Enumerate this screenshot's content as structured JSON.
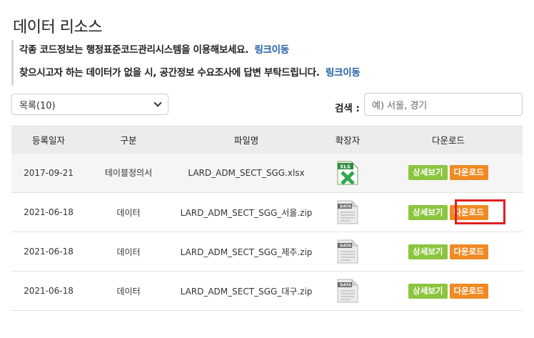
{
  "page": {
    "title": "데이터 리소스"
  },
  "notice": {
    "line1": "각종 코드정보는 행정표준코드관리시스템을 이용해보세요.",
    "line1_link": "링크이동",
    "line2": "찾으시고자 하는 데이터가 없을 시, 공간정보 수요조사에 답변 부탁드립니다.",
    "line2_link": "링크이동"
  },
  "filter": {
    "list_select_value": "목록(10)",
    "search_label": "검색 :",
    "search_placeholder": "예) 서울, 경기"
  },
  "table": {
    "headers": [
      "등록일자",
      "구분",
      "파일명",
      "확장자",
      "다운로드"
    ],
    "rows": [
      {
        "date": "2017-09-21",
        "type": "테이블정의서",
        "file": "LARD_ADM_SECT_SGG.xlsx",
        "ext_icon": "xls-file-icon",
        "detail_label": "상세보기",
        "download_label": "다운로드"
      },
      {
        "date": "2021-06-18",
        "type": "데이터",
        "file": "LARD_ADM_SECT_SGG_서울.zip",
        "ext_icon": "data-file-icon",
        "detail_label": "상세보기",
        "download_label": "다운로드"
      },
      {
        "date": "2021-06-18",
        "type": "데이터",
        "file": "LARD_ADM_SECT_SGG_제주.zip",
        "ext_icon": "data-file-icon",
        "detail_label": "상세보기",
        "download_label": "다운로드"
      },
      {
        "date": "2021-06-18",
        "type": "데이터",
        "file": "LARD_ADM_SECT_SGG_대구.zip",
        "ext_icon": "data-file-icon",
        "detail_label": "상세보기",
        "download_label": "다운로드"
      }
    ]
  },
  "icons": {
    "xls_text": "XLS",
    "data_text": "DATA"
  },
  "colors": {
    "detail_button": "#8bc53f",
    "download_button": "#f08a24",
    "link": "#1f5fa8",
    "highlight": "#e02020"
  }
}
